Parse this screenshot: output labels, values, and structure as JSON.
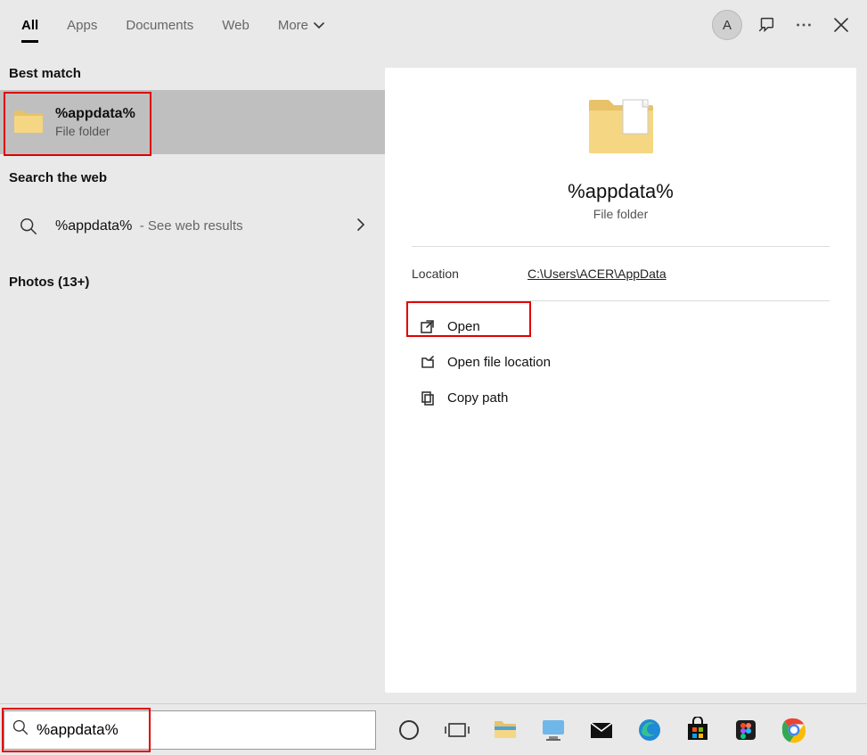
{
  "tabs": {
    "all": "All",
    "apps": "Apps",
    "documents": "Documents",
    "web": "Web",
    "more": "More"
  },
  "avatar": "A",
  "left": {
    "bestMatchHeader": "Best match",
    "bestMatch": {
      "title": "%appdata%",
      "subtitle": "File folder"
    },
    "webHeader": "Search the web",
    "webResult": {
      "title": "%appdata%",
      "aux": "- See web results"
    },
    "photosHeader": "Photos (13+)"
  },
  "detail": {
    "title": "%appdata%",
    "subtitle": "File folder",
    "locationLabel": "Location",
    "locationPath": "C:\\Users\\ACER\\AppData",
    "actions": {
      "open": "Open",
      "openLocation": "Open file location",
      "copyPath": "Copy path"
    }
  },
  "search": {
    "value": "%appdata%"
  }
}
